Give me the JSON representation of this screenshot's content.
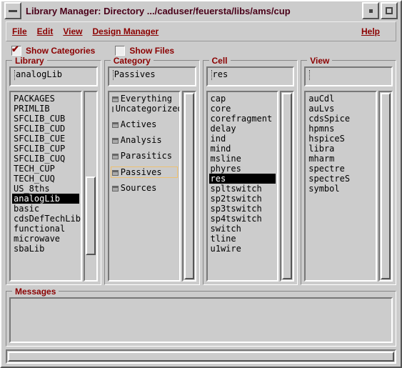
{
  "window": {
    "title": "Library Manager: Directory .../caduser/feuersta/libs/ams/cup"
  },
  "menu": {
    "file": "File",
    "edit": "Edit",
    "view": "View",
    "design_manager": "Design Manager",
    "help": "Help"
  },
  "options": {
    "show_categories": "Show Categories",
    "show_files": "Show Files",
    "show_categories_checked": true,
    "show_files_checked": false
  },
  "panels": {
    "library": {
      "title": "Library",
      "entry": "analogLib",
      "items": [
        "PACKAGES",
        "PRIMLIB",
        "SFCLIB_CUB",
        "SFCLIB_CUD",
        "SFCLIB_CUE",
        "SFCLIB_CUP",
        "SFCLIB_CUQ",
        "TECH_CUP",
        "TECH_CUQ",
        "US_8ths",
        "analogLib",
        "basic",
        "cdsDefTechLib",
        "functional",
        "microwave",
        "sbaLib"
      ],
      "selected": "analogLib"
    },
    "category": {
      "title": "Category",
      "entry": "Passives",
      "items": [
        "Everything",
        "Uncategorized",
        "Actives",
        "Analysis",
        "Parasitics",
        "Passives",
        "Sources"
      ],
      "highlighted": "Passives",
      "has_icons": true
    },
    "cell": {
      "title": "Cell",
      "entry": "res",
      "items": [
        "cap",
        "core",
        "corefragment",
        "delay",
        "ind",
        "mind",
        "msline",
        "phyres",
        "res",
        "spltswitch",
        "sp2tswitch",
        "sp3tswitch",
        "sp4tswitch",
        "switch",
        "tline",
        "u1wire"
      ],
      "selected": "res"
    },
    "view": {
      "title": "View",
      "entry": "",
      "items": [
        "auCdl",
        "auLvs",
        "cdsSpice",
        "hpmns",
        "hspiceS",
        "libra",
        "mharm",
        "spectre",
        "spectreS",
        "symbol"
      ]
    }
  },
  "messages": {
    "title": "Messages",
    "content": ""
  }
}
